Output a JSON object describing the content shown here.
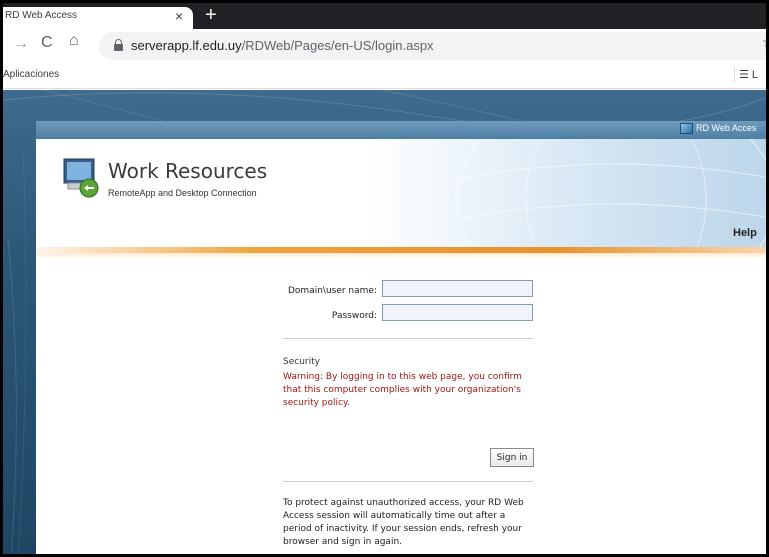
{
  "browser": {
    "tab_title": "RD Web Access",
    "tab_close": "×",
    "new_tab": "+",
    "nav_forward": "→",
    "nav_reload": "C",
    "nav_home": "⌂",
    "url_host": "serverapp.lf.edu.uy",
    "url_path": "/RDWeb/Pages/en-US/login.aspx",
    "star": "☆",
    "bookmarks_apps": "Aplicaciones",
    "reading_list": "☰ L"
  },
  "panel": {
    "top_link": "RD Web Acces",
    "title": "Work Resources",
    "subtitle": "RemoteApp and Desktop Connection",
    "help": "Help"
  },
  "form": {
    "username_label": "Domain\\user name:",
    "password_label": "Password:",
    "username_value": "",
    "password_value": "",
    "security_title": "Security",
    "security_warning": "Warning: By logging in to this web page, you confirm that this computer complies with your organization's security policy.",
    "signin_label": "Sign in",
    "timeout_text": "To protect against unauthorized access, your RD Web Access session will automatically time out after a period of inactivity. If your session ends, refresh your browser and sign in again."
  },
  "colors": {
    "warning": "#a31515",
    "accent_orange": "#f0a33a",
    "page_blue": "#2c5878"
  }
}
